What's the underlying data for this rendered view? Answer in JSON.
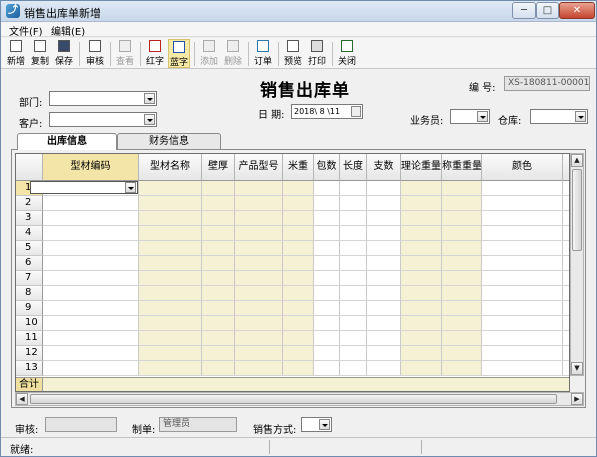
{
  "window": {
    "title": "销售出库单新增",
    "app_icon": "app-icon",
    "min_label": "─",
    "max_label": "□",
    "close_label": "✕"
  },
  "menu": [
    {
      "label": "文件(F)"
    },
    {
      "label": "编辑(E)"
    }
  ],
  "toolbar": [
    {
      "label": "新增",
      "icon": "new-file-icon",
      "enabled": true
    },
    {
      "label": "复制",
      "icon": "copy-icon",
      "enabled": true
    },
    {
      "label": "保存",
      "icon": "save-icon",
      "enabled": true
    },
    {
      "label": "审核",
      "icon": "audit-icon",
      "enabled": true
    },
    {
      "label": "查看",
      "icon": "view-icon",
      "enabled": false
    },
    {
      "label": "红字",
      "icon": "red-pen-icon",
      "enabled": true
    },
    {
      "label": "蓝字",
      "icon": "blue-pen-icon",
      "enabled": true,
      "active": true
    },
    {
      "label": "添加",
      "icon": "add-row-icon",
      "enabled": false
    },
    {
      "label": "删除",
      "icon": "delete-row-icon",
      "enabled": false
    },
    {
      "label": "订单",
      "icon": "order-icon",
      "enabled": true
    },
    {
      "label": "预览",
      "icon": "preview-icon",
      "enabled": true
    },
    {
      "label": "打印",
      "icon": "printer-icon",
      "enabled": true
    },
    {
      "label": "关闭",
      "icon": "exit-icon",
      "enabled": true
    }
  ],
  "form": {
    "title": "销售出库单",
    "number_label": "编 号:",
    "number_value": "XS-180811-00001",
    "dept_label": "部门:",
    "dept_value": "",
    "customer_label": "客户:",
    "customer_value": "",
    "date_label": "日 期:",
    "date_value": "2018\\ 8 \\11",
    "salesman_label": "业务员:",
    "warehouse_label": "仓库:"
  },
  "tabs": [
    {
      "label": "出库信息",
      "selected": true
    },
    {
      "label": "财务信息",
      "selected": false
    }
  ],
  "grid": {
    "columns": [
      "型材编码",
      "型材名称",
      "壁厚",
      "产品型号",
      "米重",
      "包数",
      "长度",
      "支数",
      "理论重量",
      "称重重量",
      "颜色"
    ],
    "rows": [
      "1",
      "2",
      "3",
      "4",
      "5",
      "6",
      "7",
      "8",
      "9",
      "10",
      "11",
      "12",
      "13"
    ],
    "total_label": "合计",
    "current_row": 1
  },
  "footer": {
    "audit_label": "审核:",
    "audit_value": "",
    "maker_label": "制单:",
    "maker_value": "管理员",
    "sale_mode_label": "销售方式:"
  },
  "status": {
    "text": "就绪:"
  },
  "colors": {
    "highlight": "#f3e4a7",
    "readonly_column": "#f4f1d4",
    "selected_toolbar": "#f5e9a8"
  }
}
